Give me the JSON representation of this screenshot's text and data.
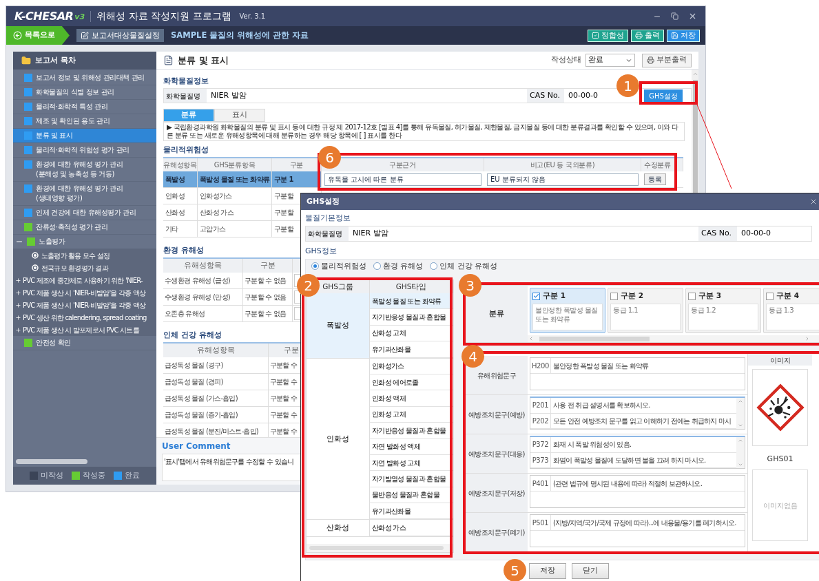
{
  "app": {
    "logo": "K-CHESAR",
    "logo_version": "v3",
    "title": "위해성 자료 작성지원 프로그램",
    "version": "Ver. 3.1"
  },
  "nav": {
    "back": "목록으로",
    "target_button": "보고서대상물질설정",
    "report_title": "SAMPLE 물질의 위해성에 관한 자료",
    "buttons": [
      {
        "label": "정합성",
        "kind": "check"
      },
      {
        "label": "출력",
        "kind": "print"
      },
      {
        "label": "저장",
        "kind": "save"
      }
    ]
  },
  "sidebar": {
    "title": "보고서 목차",
    "items": [
      {
        "label": "보고서 정보 및 위해성 관리대책 관리",
        "color": "#2f9cf2",
        "selected": false
      },
      {
        "label": "화학물질의 식별 정보 관리",
        "color": "#2f9cf2",
        "selected": false
      },
      {
        "label": "물리적·화학적 특성 관리",
        "color": "#2f9cf2",
        "selected": false
      },
      {
        "label": "제조 및 확인된 용도 관리",
        "color": "#2f9cf2",
        "selected": false
      },
      {
        "label": "분류 및 표시",
        "color": "#2f9cf2",
        "selected": true
      },
      {
        "label": "물리적·화학적 위험성 평가 관리",
        "color": "#2f9cf2",
        "selected": false
      },
      {
        "label": "환경에 대한 유해성 평가 관리",
        "note": "(분해성 및 농축성 등 거동)",
        "color": "#2f9cf2",
        "selected": false
      },
      {
        "label": "환경에 대한 유해성 평가 관리",
        "note": "(생태영향 평가)",
        "color": "#2f9cf2",
        "selected": false
      },
      {
        "label": "인체 건강에 대한 유해성평가 관리",
        "color": "#2f9cf2",
        "selected": false
      },
      {
        "label": "잔류성·축적성 평가 관리",
        "color": "#66cc33",
        "selected": false
      },
      {
        "label": "노출평가",
        "color": "#66cc33",
        "selected": false,
        "expanded": true,
        "children": [
          {
            "label": "노출평가 활용 모수 설정",
            "kind": "setting"
          },
          {
            "label": "전국규모 환경평가 결과",
            "kind": "setting"
          },
          {
            "label": "PVC 제조에 중간체로 사용하기 위한 'NIER-",
            "kind": "scenario",
            "expanded": false
          },
          {
            "label": "PVC 제품 생산 시 'NIER-비발암'을 각종 액상",
            "kind": "scenario",
            "expanded": false
          },
          {
            "label": "PVC 제품 생산 시 'NIER-비발암'을 각종 액상",
            "kind": "scenario",
            "expanded": false
          },
          {
            "label": "PVC 생산 위한 calendering, spread coating",
            "kind": "scenario",
            "expanded": false
          },
          {
            "label": "PVC 제품 생산 시 발포제로서 PVC 시트를",
            "kind": "scenario",
            "expanded": false
          }
        ]
      },
      {
        "label": "안전성 확인",
        "color": "#66cc33",
        "selected": false
      }
    ],
    "legend": [
      {
        "label": "미작성",
        "color": "#3b4457"
      },
      {
        "label": "작성중",
        "color": "#66cc33"
      },
      {
        "label": "완료",
        "color": "#2f9cf2"
      }
    ]
  },
  "content": {
    "title": "분류 및 표시",
    "status_label": "작성상태",
    "status_value": "완료",
    "print_button": "부분출력",
    "chem_info": {
      "title": "화학물질정보",
      "name_label": "화학물질명",
      "name": "NIER 발암",
      "cas_label": "CAS No.",
      "cas": "00-00-0",
      "ghs_button": "GHS설정"
    },
    "tabs": [
      {
        "label": "분류",
        "selected": true
      },
      {
        "label": "표시",
        "selected": false
      }
    ],
    "notice": "▶ 국립환경과학원 화학물질의 분류 및 표시 등에 대한 규정 제 2017-12호 [별표 4]를 통해 유독물질, 허가물질, 제한물질, 금지물질 등에 대한 분류결과를 확인할 수 있으며, 이와 다른 분류 또는 새로운 유해성항목에 대해 분류하는 경우 해당 항목에 [ ] 표시를 한다",
    "physical": {
      "title": "물리적위험성",
      "columns": [
        "유해성항목",
        "GHS분류항목",
        "구분",
        "구분근거",
        "비고(EU 등 국외분류)",
        "수정분류"
      ],
      "rows": [
        {
          "selected": true,
          "cells": [
            "폭발성",
            "폭발성 물질 또는 화약류",
            "구분 1"
          ],
          "basis": "유독물 고시에 따른 분류",
          "note": "EU 분류되지 않음",
          "action": "등록"
        },
        {
          "selected": false,
          "cells": [
            "인화성",
            "인화성가스",
            "구분할"
          ]
        },
        {
          "selected": false,
          "cells": [
            "산화성",
            "산화성 가스",
            "구분할"
          ]
        },
        {
          "selected": false,
          "cells": [
            "기타",
            "고압가스",
            "구분할"
          ]
        }
      ]
    },
    "environment": {
      "title": "환경 유해성",
      "columns": [
        "유해성항목",
        "구분"
      ],
      "rows": [
        {
          "cells": [
            "수생환경 유해성 (급성)",
            "구분할 수 없음"
          ]
        },
        {
          "cells": [
            "수생환경 유해성 (만성)",
            "구분할 수 없음"
          ]
        },
        {
          "cells": [
            "오존층 유해성",
            "구분할 수 없음"
          ]
        }
      ]
    },
    "health": {
      "title": "인체 건강 유해성",
      "columns": [
        "유해성항목",
        "구분"
      ],
      "rows": [
        {
          "cells": [
            "급성독성 물질 (경구)",
            "구분할 수"
          ]
        },
        {
          "cells": [
            "급성독성 물질 (경피)",
            "구분할 수"
          ]
        },
        {
          "cells": [
            "급성독성 물질 (가스-흡입)",
            "구분할 수"
          ]
        },
        {
          "cells": [
            "급성독성 물질 (증기-흡입)",
            "구분할 수"
          ]
        },
        {
          "cells": [
            "급성독성 물질 (분진/미스트-흡입)",
            "구분할 수"
          ]
        }
      ]
    },
    "comment": {
      "title": "User Comment",
      "text": "'표시'탭에서 유해위험문구를 수정할 수 있습니"
    }
  },
  "dialog": {
    "title": "GHS설정",
    "basic": {
      "title": "물질기본정보",
      "name_label": "화학물질명",
      "name": "NIER 발암",
      "cas_label": "CAS No.",
      "cas": "00-00-0"
    },
    "ghs_title": "GHS정보",
    "radios": [
      {
        "label": "물리적위험성",
        "selected": true
      },
      {
        "label": "환경 유해성",
        "selected": false
      },
      {
        "label": "인체 건강 유해성",
        "selected": false
      }
    ],
    "groups_table": {
      "columns": [
        "GHS그룹",
        "GHS타입"
      ],
      "groups": [
        {
          "label": "폭발성",
          "selected": true,
          "types": [
            {
              "label": "폭발성 물질 또는 화약류",
              "selected": true
            },
            {
              "label": "자기반응성 물질과 혼합물",
              "selected": false
            },
            {
              "label": "산화성 고체",
              "selected": false
            },
            {
              "label": "유기과산화물",
              "selected": false
            }
          ]
        },
        {
          "label": "인화성",
          "selected": false,
          "types": [
            {
              "label": "인화성가스",
              "selected": false
            },
            {
              "label": "인화성 에어로졸",
              "selected": false
            },
            {
              "label": "인화성 액체",
              "selected": false
            },
            {
              "label": "인화성 고체",
              "selected": false
            },
            {
              "label": "자기반응성 물질과 혼합물",
              "selected": false
            },
            {
              "label": "자연 발화성 액체",
              "selected": false
            },
            {
              "label": "자연 발화성 고체",
              "selected": false
            },
            {
              "label": "자기발열성  물질과 혼합물",
              "selected": false
            },
            {
              "label": "물반응성 물질과 혼합물",
              "selected": false
            },
            {
              "label": "유기과산화물",
              "selected": false
            }
          ]
        },
        {
          "label": "산화성",
          "selected": false,
          "types": [
            {
              "label": "산화성 가스",
              "selected": false
            }
          ]
        }
      ]
    },
    "classification": {
      "label": "분류",
      "cards": [
        {
          "title": "구분 1",
          "description": "불안정한 폭발성 물질 또는 화약류",
          "checked": true
        },
        {
          "title": "구분 2",
          "description": "등급 1.1",
          "checked": false
        },
        {
          "title": "구분 3",
          "description": "등급 1.2",
          "checked": false
        },
        {
          "title": "구분 4",
          "description": "등급 1.3",
          "checked": false
        }
      ]
    },
    "statements": [
      {
        "label": "유해위험문구",
        "scrollable": false,
        "items": [
          {
            "code": "H200",
            "text": "불안정한 폭발성 물질 또는 화약류"
          }
        ]
      },
      {
        "label": "예방조치문구(예방)",
        "scrollable": true,
        "items": [
          {
            "code": "P201",
            "text": "사용 전 취급 설명서를 확보하시오."
          },
          {
            "code": "P202",
            "text": "모든 안전 예방조치 문구를 읽고 이해하기 전에는 취급하지 마시"
          }
        ]
      },
      {
        "label": "예방조치문구(대응)",
        "scrollable": true,
        "items": [
          {
            "code": "P372",
            "text": "화재 시 폭발 위험성이 있음."
          },
          {
            "code": "P373",
            "text": "화염이 폭발성 물질에 도달하면 불을 끄려 하지 마시오."
          }
        ]
      },
      {
        "label": "예방조치문구(저장)",
        "scrollable": false,
        "items": [
          {
            "code": "P401",
            "text": "(관련 법규에 명시된 내용에 따라) 적절히 보관하시오."
          }
        ]
      },
      {
        "label": "예방조치문구(폐기)",
        "scrollable": false,
        "items": [
          {
            "code": "P501",
            "text": "(지방/지역/국가/국제 규정에 따라)...에 내용물/용기를 폐기하시오."
          }
        ]
      }
    ],
    "image": {
      "header": "이미지",
      "code": "GHS01",
      "empty": "이미지없음"
    },
    "buttons": [
      "저장",
      "닫기"
    ]
  },
  "callouts": [
    {
      "number": "1",
      "framed": true
    },
    {
      "number": "6",
      "framed": true
    },
    {
      "number": "2",
      "framed": true
    },
    {
      "number": "3",
      "framed": true
    },
    {
      "number": "4",
      "framed": true
    },
    {
      "number": "5",
      "framed": false
    }
  ]
}
